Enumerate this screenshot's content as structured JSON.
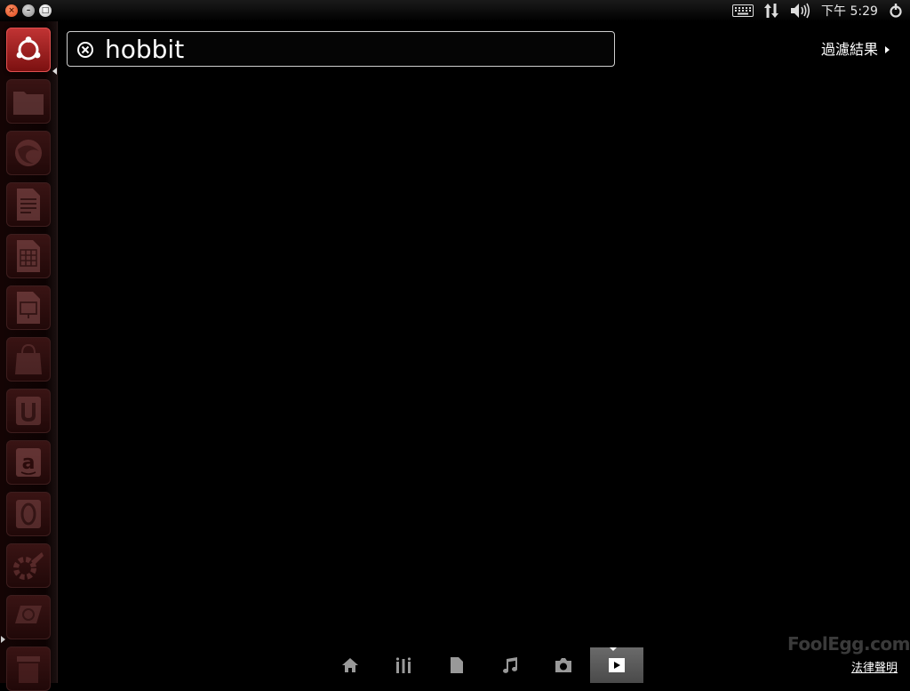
{
  "window_controls": {
    "close": "×",
    "minimize": "–",
    "maximize": "□"
  },
  "panel": {
    "clock": "下午 5:29",
    "indicators": [
      "keyboard-icon",
      "network-icon",
      "sound-icon",
      "session-gear-icon"
    ]
  },
  "launcher": {
    "items": [
      "ubuntu-dash",
      "files",
      "firefox",
      "libreoffice-writer",
      "libreoffice-calc",
      "libreoffice-impress",
      "ubuntu-software-center",
      "ubuntu-one",
      "amazon",
      "ubuntu-one-music",
      "system-settings",
      "workspace-switcher",
      "trash"
    ]
  },
  "search": {
    "query": "hobbit"
  },
  "filter": {
    "label": "過濾結果"
  },
  "lenses": {
    "items": [
      "home-lens",
      "applications-lens",
      "files-lens",
      "music-lens",
      "photos-lens",
      "video-lens"
    ],
    "active": "video-lens"
  },
  "footer": {
    "watermark": "FoolEgg.com",
    "legal": "法律聲明"
  },
  "colors": {
    "accent": "#c23434",
    "background": "#000000"
  }
}
